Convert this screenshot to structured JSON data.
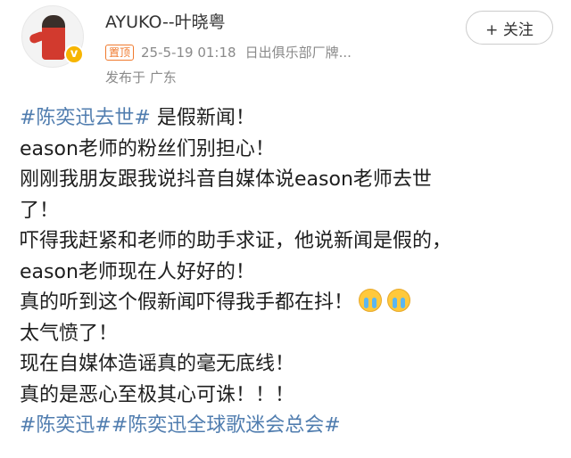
{
  "user": {
    "name": "AYUKO--叶晓粤",
    "verified_mark": "v"
  },
  "post_meta": {
    "pin_label": "置顶",
    "timestamp": "25-5-19 01:18",
    "source": "日出俱乐部厂牌...",
    "location": "发布于 广东"
  },
  "follow_button": {
    "label": "+ 关注"
  },
  "content": {
    "line1_topic": "#陈奕迅去世#",
    "line1_text": " 是假新闻！",
    "line2": "eason老师的粉丝们别担心！",
    "line3": "刚刚我朋友跟我说抖音自媒体说eason老师去世",
    "line4": "了！",
    "line5": "吓得我赶紧和老师的助手求证，他说新闻是假的，",
    "line6": "eason老师现在人好好的！",
    "line7_text": "真的听到这个假新闻吓得我手都在抖！",
    "line7_emojis": [
      "crying-face-emoji",
      "crying-face-emoji"
    ],
    "line8": "太气愤了！",
    "line9": "现在自媒体造谣真的毫无底线！",
    "line10": "真的是恶心至极其心可诛！！！",
    "line11_topics": "#陈奕迅##陈奕迅全球歌迷会总会#"
  },
  "colors": {
    "topic": "#507daf",
    "text": "#1e1e1e",
    "meta": "#8a8a8a",
    "pin": "#f07a2e"
  }
}
